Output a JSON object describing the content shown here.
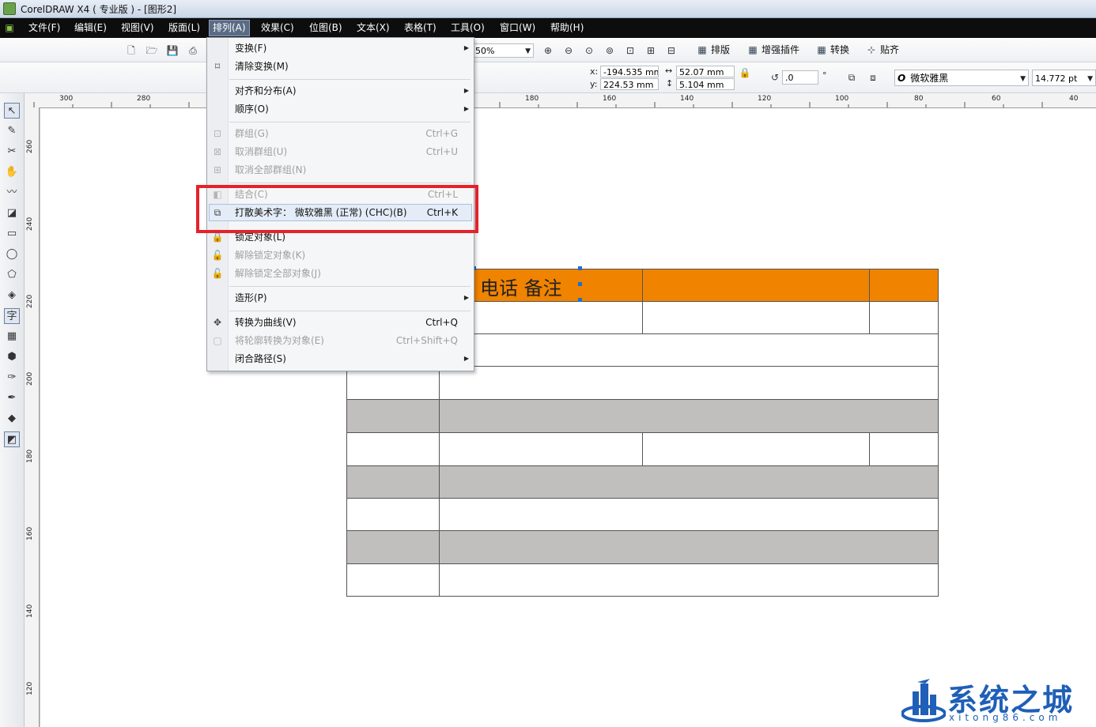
{
  "window": {
    "title": "CorelDRAW X4 ( 专业版 ) - [图形2]"
  },
  "menubar": {
    "items": [
      "文件(F)",
      "编辑(E)",
      "视图(V)",
      "版面(L)",
      "排列(A)",
      "效果(C)",
      "位图(B)",
      "文本(X)",
      "表格(T)",
      "工具(O)",
      "窗口(W)",
      "帮助(H)"
    ],
    "active": "排列(A)"
  },
  "toolbar": {
    "zoom": "50%",
    "plugins": [
      "排版",
      "增强插件",
      "转换",
      "贴齐"
    ]
  },
  "properties": {
    "x_label": "x:",
    "x_value": "-194.535 mm",
    "y_label": "y:",
    "y_value": "224.53 mm",
    "width_value": "52.07 mm",
    "height_value": "5.104 mm",
    "rotation_value": ".0",
    "rotation_unit": "°",
    "font_name": "微软雅黑",
    "font_size": "14.772 pt"
  },
  "ruler": {
    "h_ticks": [
      "300",
      "280",
      "180",
      "160",
      "140",
      "120",
      "100",
      "80",
      "60",
      "40"
    ],
    "v_ticks": [
      "260",
      "240",
      "220",
      "200",
      "180",
      "160",
      "140",
      "120"
    ]
  },
  "arrange_menu": {
    "items": [
      {
        "label": "变换(F)",
        "shortcut": "",
        "disabled": false,
        "submenu": true
      },
      {
        "label": "清除变换(M)",
        "shortcut": "",
        "disabled": false,
        "submenu": false
      },
      {
        "label": "对齐和分布(A)",
        "shortcut": "",
        "disabled": false,
        "submenu": true
      },
      {
        "label": "顺序(O)",
        "shortcut": "",
        "disabled": false,
        "submenu": true
      },
      {
        "label": "群组(G)",
        "shortcut": "Ctrl+G",
        "disabled": true,
        "submenu": false
      },
      {
        "label": "取消群组(U)",
        "shortcut": "Ctrl+U",
        "disabled": true,
        "submenu": false
      },
      {
        "label": "取消全部群组(N)",
        "shortcut": "",
        "disabled": true,
        "submenu": false
      },
      {
        "label": "结合(C)",
        "shortcut": "Ctrl+L",
        "disabled": true,
        "submenu": false
      },
      {
        "label": "打散美术字： 微软雅黑 (正常) (CHC)(B)",
        "shortcut": "Ctrl+K",
        "disabled": false,
        "submenu": false
      },
      {
        "label": "锁定对象(L)",
        "shortcut": "",
        "disabled": false,
        "submenu": false
      },
      {
        "label": "解除锁定对象(K)",
        "shortcut": "",
        "disabled": true,
        "submenu": false
      },
      {
        "label": "解除锁定全部对象(J)",
        "shortcut": "",
        "disabled": true,
        "submenu": false
      },
      {
        "label": "造形(P)",
        "shortcut": "",
        "disabled": false,
        "submenu": true
      },
      {
        "label": "转换为曲线(V)",
        "shortcut": "Ctrl+Q",
        "disabled": false,
        "submenu": false
      },
      {
        "label": "将轮廓转换为对象(E)",
        "shortcut": "Ctrl+Shift+Q",
        "disabled": true,
        "submenu": false
      },
      {
        "label": "闭合路径(S)",
        "shortcut": "",
        "disabled": false,
        "submenu": true
      }
    ]
  },
  "canvas": {
    "header_text": "电话  备注"
  },
  "watermark": {
    "title": "系统之城",
    "url": "xitong86.com"
  },
  "colors": {
    "menubar": "#0d0d0d",
    "header_row": "#f08300",
    "shaded_row": "#c0bfbd",
    "highlight_box": "#e5212a",
    "watermark": "#1f5fb7"
  }
}
